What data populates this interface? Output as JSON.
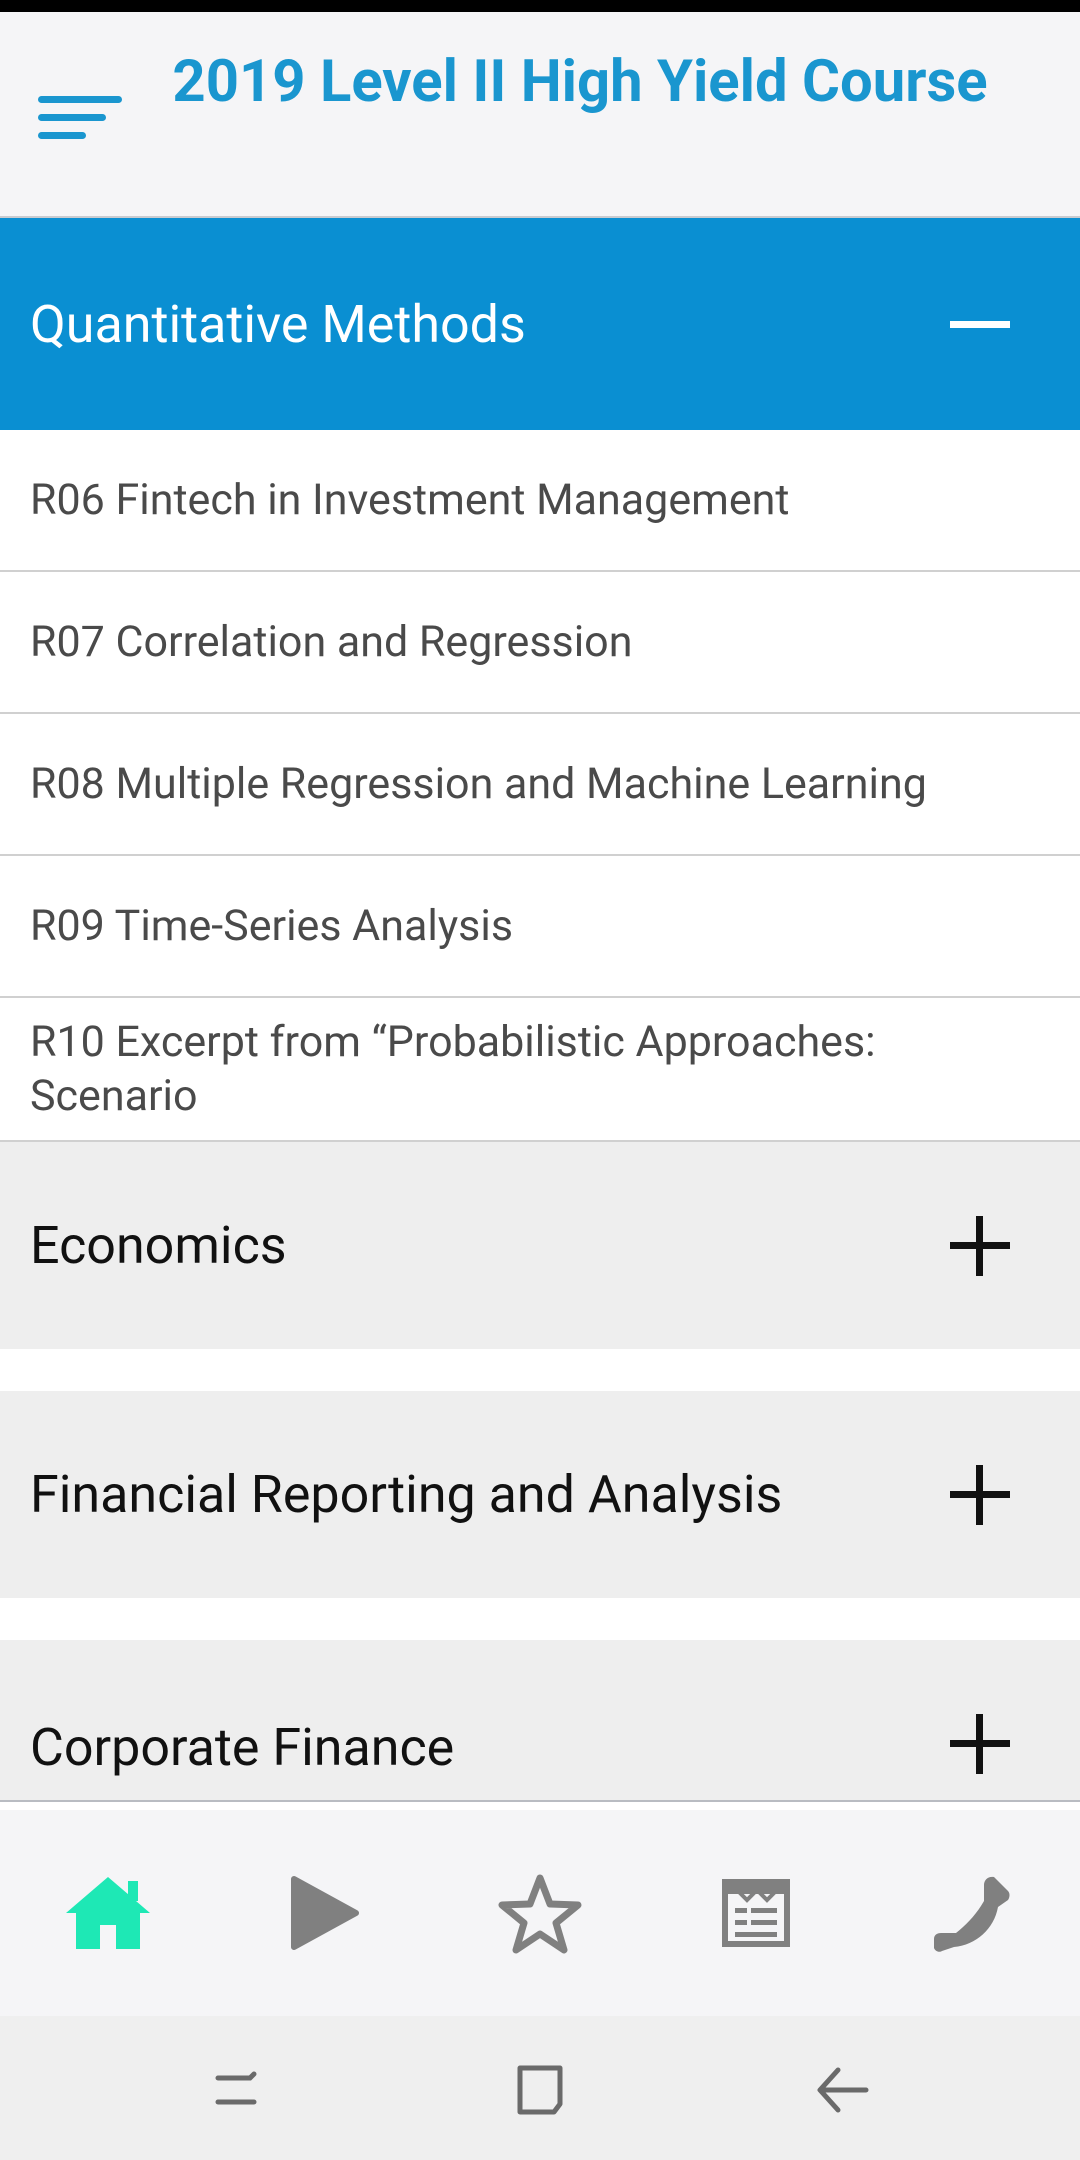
{
  "header": {
    "title": "2019 Level II High Yield Course"
  },
  "sections": [
    {
      "label": "Quantitative Methods",
      "state": "expanded",
      "items": [
        "R06 Fintech in Investment Management",
        "R07 Correlation and Regression",
        "R08 Multiple Regression and Machine Learning",
        "R09 Time-Series Analysis",
        "R10 Excerpt from “Probabilistic Approaches: Scenario"
      ]
    },
    {
      "label": "Economics",
      "state": "collapsed"
    },
    {
      "label": "Financial Reporting and Analysis",
      "state": "collapsed"
    },
    {
      "label": "Corporate Finance",
      "state": "collapsed"
    }
  ],
  "tabs": [
    {
      "icon": "home-icon",
      "active": true
    },
    {
      "icon": "play-icon",
      "active": false
    },
    {
      "icon": "star-icon",
      "active": false
    },
    {
      "icon": "notes-icon",
      "active": false
    },
    {
      "icon": "phone-icon",
      "active": false
    }
  ],
  "system_nav": [
    {
      "icon": "recent-apps-icon"
    },
    {
      "icon": "home-square-icon"
    },
    {
      "icon": "back-icon"
    }
  ],
  "colors": {
    "brand_blue": "#1a96cf",
    "section_active_bg": "#0a8fd2",
    "tab_active": "#1ee8b5",
    "tab_inactive": "#808080"
  }
}
